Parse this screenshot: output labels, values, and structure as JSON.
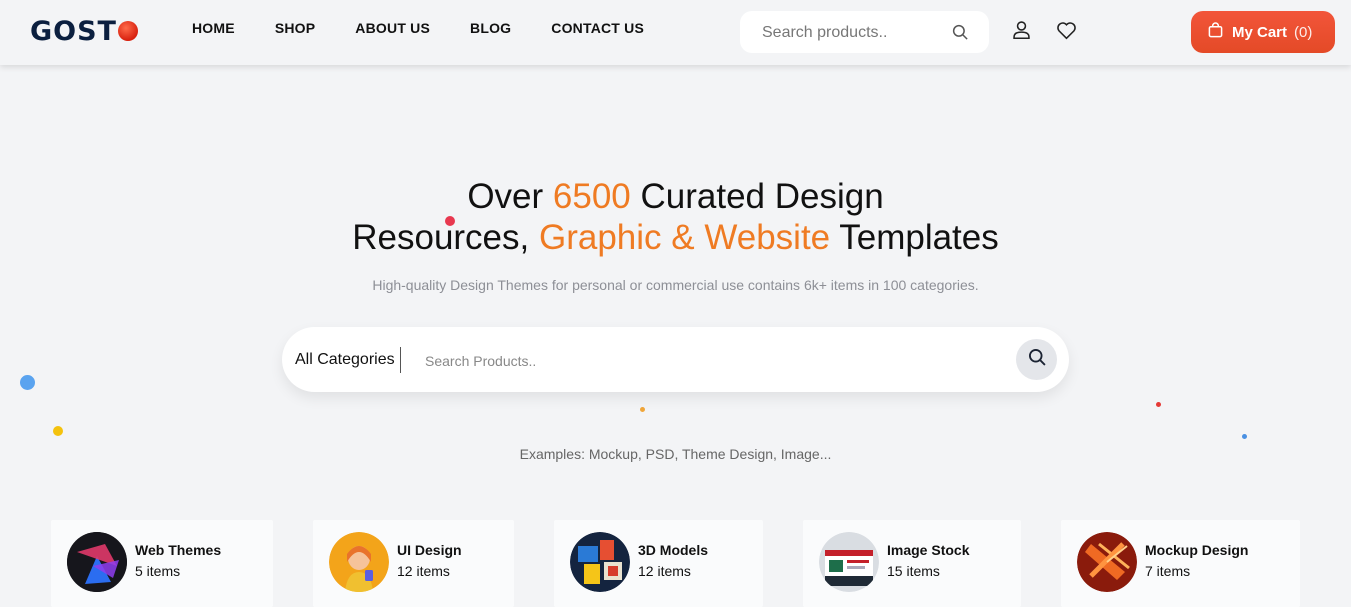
{
  "brand": {
    "logo_prefix": "GOST",
    "logo_suffix_icon": "red-ball-o"
  },
  "nav": {
    "items": [
      {
        "label": "HOME"
      },
      {
        "label": "SHOP"
      },
      {
        "label": "ABOUT US"
      },
      {
        "label": "BLOG"
      },
      {
        "label": "CONTACT US"
      }
    ]
  },
  "header_search": {
    "placeholder": "Search products..",
    "icon": "search-icon"
  },
  "header_icons": {
    "account": "user-icon",
    "wishlist": "heart-icon"
  },
  "cart": {
    "label": "My Cart",
    "count": "(0)",
    "icon": "shopping-bag-icon"
  },
  "hero": {
    "line1_pre": "Over ",
    "line1_highlight": "6500",
    "line1_post": " Curated Design",
    "line2_pre": "Resources, ",
    "line2_highlight": "Graphic & Website",
    "line2_post": " Templates",
    "subtitle": "High-quality Design Themes for personal or commercial use contains 6k+ items in 100 categories."
  },
  "main_search": {
    "category": "All Categories",
    "placeholder": "Search Products..",
    "icon": "search-icon"
  },
  "examples": "Examples: Mockup, PSD, Theme Design, Image...",
  "categories": [
    {
      "name": "Web Themes",
      "count": "5 items"
    },
    {
      "name": "UI Design",
      "count": "12 items"
    },
    {
      "name": "3D Models",
      "count": "12 items"
    },
    {
      "name": "Image Stock",
      "count": "15 items"
    },
    {
      "name": "Mockup Design",
      "count": "7 items"
    }
  ],
  "colors": {
    "accent": "#ef7b23",
    "cart": "#e94e2c",
    "navy": "#0b1f3f"
  }
}
